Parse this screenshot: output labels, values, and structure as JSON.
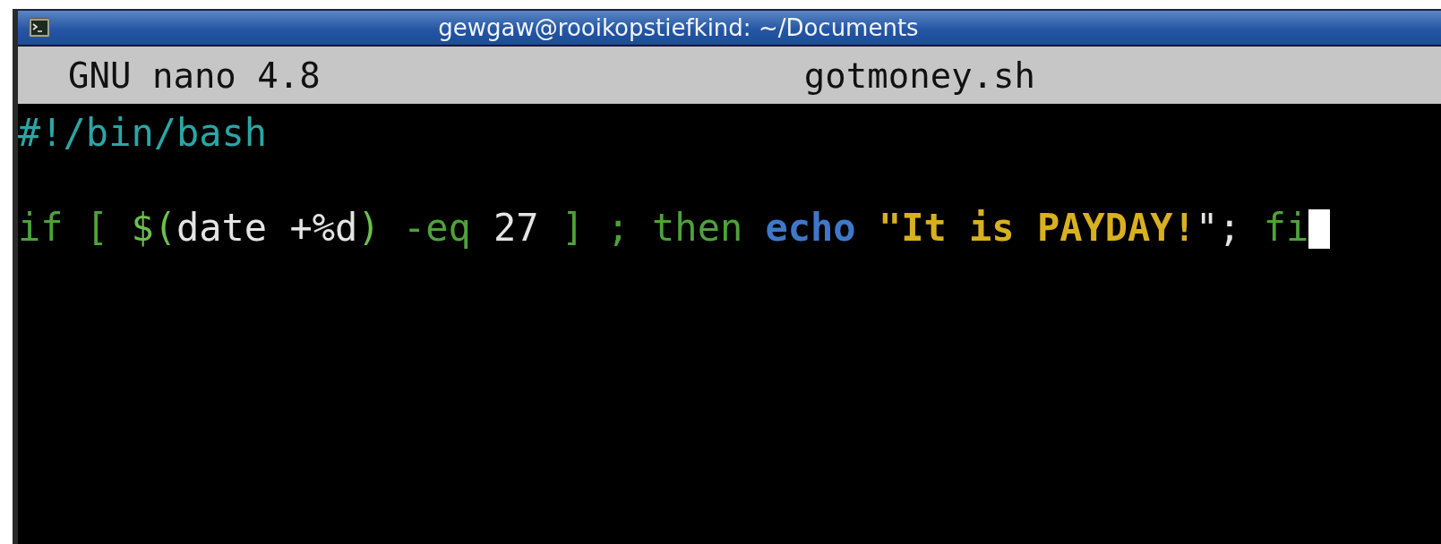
{
  "window": {
    "title": "gewgaw@rooikopstiefkind: ~/Documents"
  },
  "nano_header": {
    "version": "GNU nano 4.8",
    "filename": "gotmoney.sh"
  },
  "editor": {
    "lines": [
      {
        "kind": "code",
        "tokens": [
          {
            "kind": "comment",
            "text": "#!/bin/bash"
          }
        ]
      },
      {
        "kind": "blank"
      },
      {
        "kind": "code",
        "tokens": [
          {
            "kind": "keyword",
            "text": "if [ "
          },
          {
            "kind": "subst",
            "text": "$("
          },
          {
            "kind": "plain",
            "text": "date +%d"
          },
          {
            "kind": "subst",
            "text": ")"
          },
          {
            "kind": "keyword",
            "text": " -eq "
          },
          {
            "kind": "plain",
            "text": "27"
          },
          {
            "kind": "keyword",
            "text": " ] ; then "
          },
          {
            "kind": "builtin",
            "text": "echo "
          },
          {
            "kind": "string",
            "text": "\"It is PAYDAY!"
          },
          {
            "kind": "plain",
            "text": "\"; "
          },
          {
            "kind": "keyword",
            "text": "fi"
          }
        ],
        "cursor": true
      }
    ]
  }
}
